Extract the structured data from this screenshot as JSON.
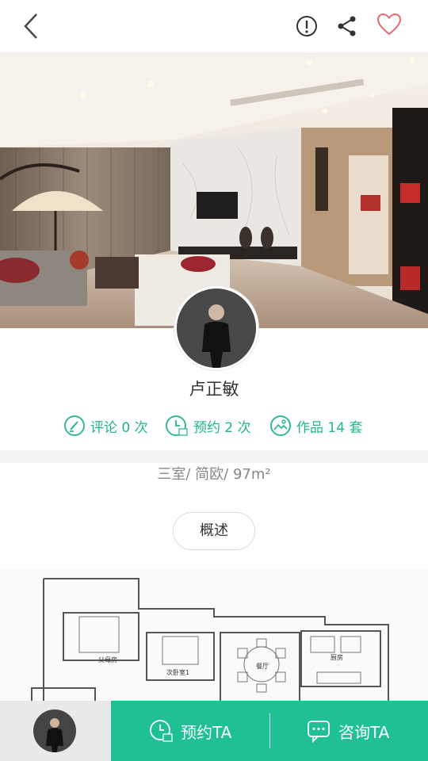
{
  "designer": {
    "name": "卢正敏"
  },
  "stats": [
    {
      "label": "评论 0 次",
      "icon": "pen-circle-icon"
    },
    {
      "label": "预约 2 次",
      "icon": "calendar-clock-icon"
    },
    {
      "label": "作品 14 套",
      "icon": "image-icon"
    }
  ],
  "project": {
    "info": "三室/ 简欧/ 97m²",
    "tab": "概述"
  },
  "floorplan": {
    "rooms": [
      "父母房",
      "次卧室1",
      "餐厅",
      "厨房"
    ]
  },
  "bottom": {
    "book": "预约TA",
    "consult": "咨询TA"
  },
  "colors": {
    "accent": "#1fc094",
    "stat_text": "#1db68d",
    "favorite": "#e8686e"
  }
}
